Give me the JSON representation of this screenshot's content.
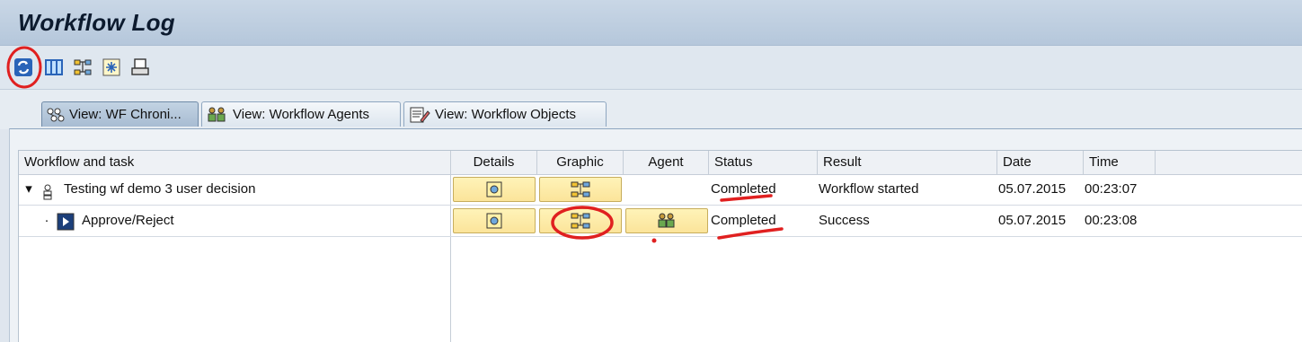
{
  "window": {
    "title": "Workflow Log"
  },
  "toolbar": {
    "buttons": [
      {
        "icon": "refresh-icon"
      },
      {
        "icon": "layout-icon"
      },
      {
        "icon": "graphic-icon"
      },
      {
        "icon": "filter-icon"
      },
      {
        "icon": "print-icon"
      }
    ]
  },
  "tabs": [
    {
      "label": "View: WF Chroni...",
      "icon": "hierarchy-icon",
      "active": true
    },
    {
      "label": "View: Workflow Agents",
      "icon": "agents-icon",
      "active": false
    },
    {
      "label": "View: Workflow Objects",
      "icon": "objects-icon",
      "active": false
    }
  ],
  "table": {
    "columns": [
      "Workflow and task",
      "Details",
      "Graphic",
      "Agent",
      "Status",
      "Result",
      "Date",
      "Time"
    ],
    "rows": [
      {
        "expander": "▾",
        "icon": "workflow-icon",
        "task": "Testing wf demo 3 user decision",
        "status": "Completed",
        "result": "Workflow started",
        "date": "05.07.2015",
        "time": "00:23:07",
        "has_agent": false
      },
      {
        "expander": "·",
        "icon": "step-icon",
        "task": "Approve/Reject",
        "status": "Completed",
        "result": "Success",
        "date": "05.07.2015",
        "time": "00:23:08",
        "has_agent": true
      }
    ]
  },
  "colors": {
    "accent": "#fbe49a",
    "annotation": "#e02020"
  }
}
